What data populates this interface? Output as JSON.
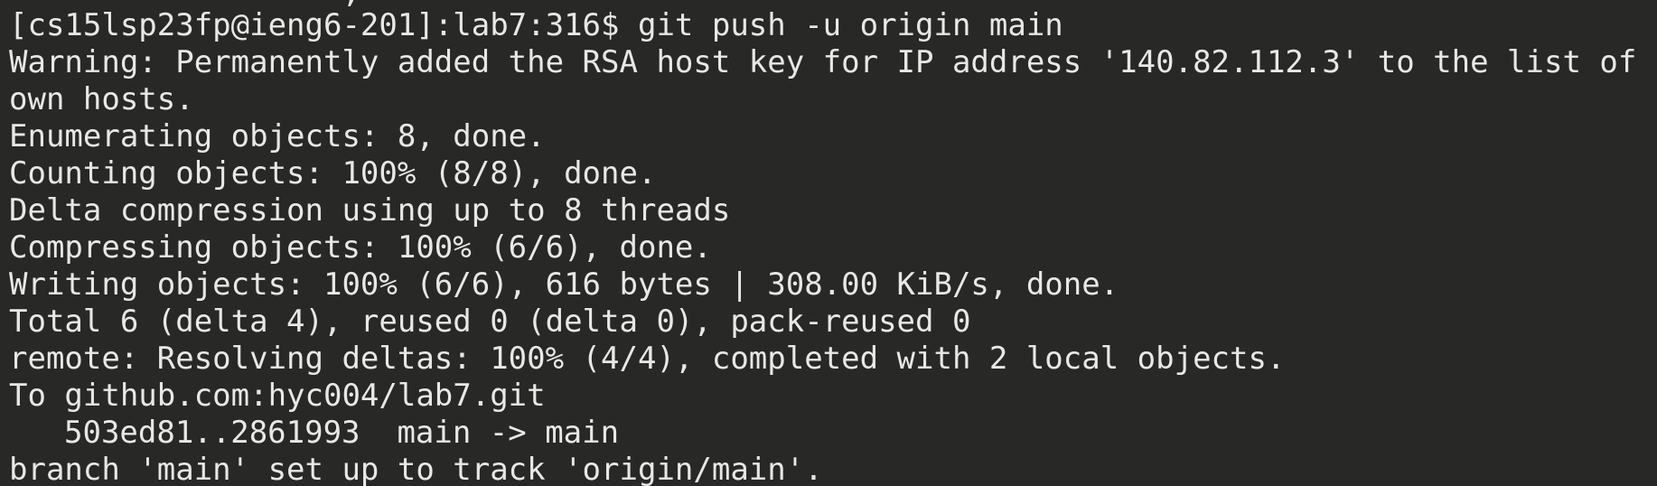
{
  "terminal": {
    "background": "#282826",
    "foreground": "#e8e8e6",
    "clipped_top": "                  ;                   ",
    "lines": [
      "[cs15lsp23fp@ieng6-201]:lab7:316$ git push -u origin main",
      "Warning: Permanently added the RSA host key for IP address '140.82.112.3' to the list of kn",
      "own hosts.",
      "Enumerating objects: 8, done.",
      "Counting objects: 100% (8/8), done.",
      "Delta compression using up to 8 threads",
      "Compressing objects: 100% (6/6), done.",
      "Writing objects: 100% (6/6), 616 bytes | 308.00 KiB/s, done.",
      "Total 6 (delta 4), reused 0 (delta 0), pack-reused 0",
      "remote: Resolving deltas: 100% (4/4), completed with 2 local objects.",
      "To github.com:hyc004/lab7.git",
      "503ed81..2861993  main -> main",
      "branch 'main' set up to track 'origin/main'."
    ]
  }
}
